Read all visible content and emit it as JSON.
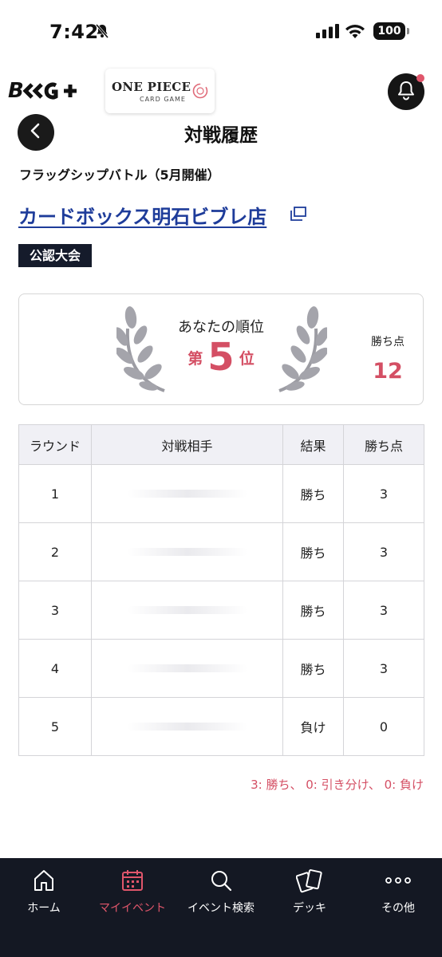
{
  "status_bar": {
    "time": "7:42",
    "battery": "100"
  },
  "header": {
    "logo_text": "B",
    "partner_logo_main": "ONE PIECE",
    "partner_logo_sub": "CARD GAME"
  },
  "page": {
    "title": "対戦履歴",
    "event_name": "フラッグシップバトル（5月開催）",
    "store_name": "カードボックス明石ビブレ店",
    "badge": "公認大会"
  },
  "ranking": {
    "label": "あなたの順位",
    "prefix": "第",
    "rank": "5",
    "suffix": "位",
    "points_label": "勝ち点",
    "points": "12"
  },
  "table": {
    "headers": [
      "ラウンド",
      "対戦相手",
      "結果",
      "勝ち点"
    ],
    "rows": [
      {
        "round": "1",
        "result": "勝ち",
        "points": "3"
      },
      {
        "round": "2",
        "result": "勝ち",
        "points": "3"
      },
      {
        "round": "3",
        "result": "勝ち",
        "points": "3"
      },
      {
        "round": "4",
        "result": "勝ち",
        "points": "3"
      },
      {
        "round": "5",
        "result": "負け",
        "points": "0"
      }
    ]
  },
  "legend": "3: 勝ち、 0: 引き分け、 0: 負け",
  "nav": {
    "items": [
      {
        "label": "ホーム",
        "icon": "home-icon"
      },
      {
        "label": "マイイベント",
        "icon": "calendar-icon"
      },
      {
        "label": "イベント検索",
        "icon": "search-icon"
      },
      {
        "label": "デッキ",
        "icon": "cards-icon"
      },
      {
        "label": "その他",
        "icon": "more-icon"
      }
    ],
    "active_index": 1
  },
  "colors": {
    "accent": "#d44f64",
    "link": "#1e3c9a",
    "nav_bg": "#141823"
  }
}
